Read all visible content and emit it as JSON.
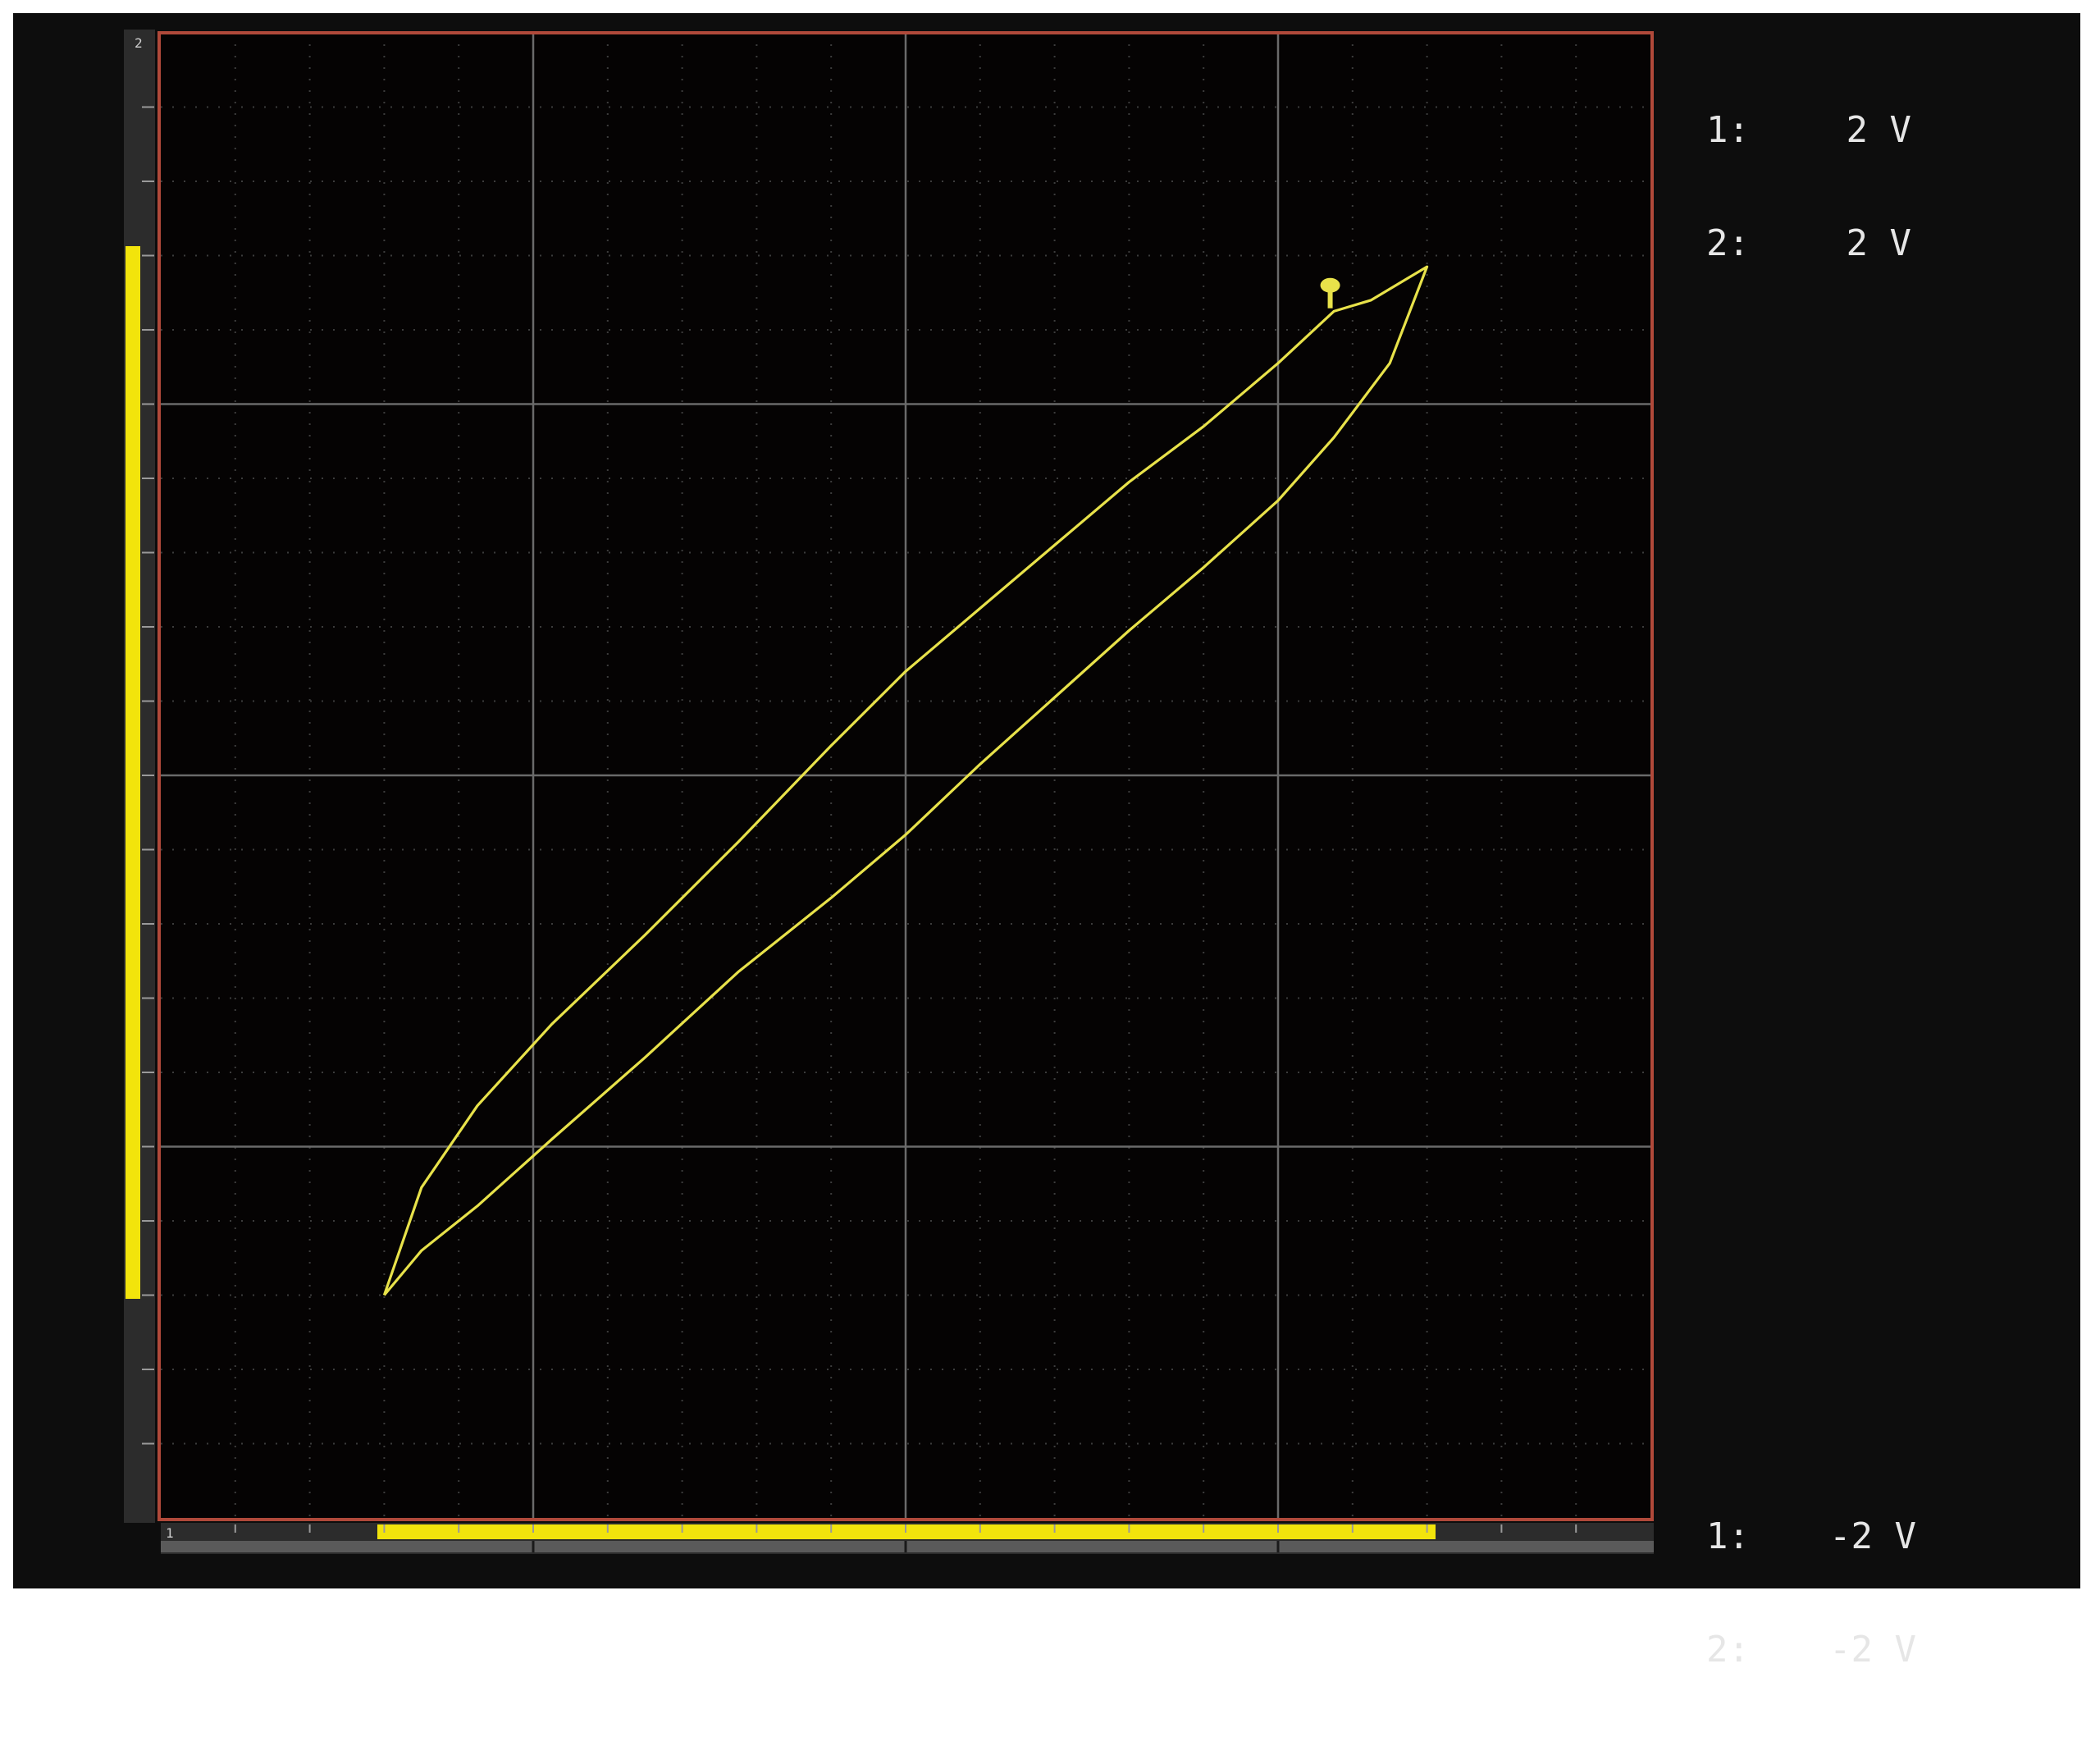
{
  "display": {
    "mode": "XY",
    "trace_color": "#e8e24a",
    "frame_color": "#b0493a",
    "grid_color": "#6a6a6a",
    "background_color": "#050303"
  },
  "y_axis_indicator": {
    "label": "2",
    "channel": 2,
    "highlight_color": "#f2e40c"
  },
  "x_axis_indicator": {
    "label": "1",
    "channel": 1,
    "highlight_color": "#f2e40c"
  },
  "readout_top": [
    {
      "channel": "1:",
      "value": "2 V"
    },
    {
      "channel": "2:",
      "value": "2 V"
    }
  ],
  "readout_bottom": [
    {
      "channel": "1:",
      "value": "-2 V"
    },
    {
      "channel": "2:",
      "value": "-2 V"
    }
  ],
  "chart_data": {
    "type": "line",
    "xlim": [
      -2,
      2
    ],
    "ylim": [
      -2,
      2
    ],
    "grid": true,
    "series": [
      {
        "x": [
          -1.4,
          -1.3,
          -1.15,
          -0.95,
          -0.7,
          -0.45,
          -0.2,
          0.0,
          0.2,
          0.4,
          0.6,
          0.8,
          1.0,
          1.15,
          1.3,
          1.4,
          1.35,
          1.25,
          1.15,
          1.0,
          0.8,
          0.6,
          0.4,
          0.2,
          0.0,
          -0.2,
          -0.45,
          -0.7,
          -0.95,
          -1.15,
          -1.3,
          -1.4
        ],
        "y": [
          -1.4,
          -1.28,
          -1.16,
          -0.98,
          -0.76,
          -0.53,
          -0.33,
          -0.16,
          0.03,
          0.21,
          0.39,
          0.56,
          0.74,
          0.91,
          1.11,
          1.37,
          1.34,
          1.28,
          1.25,
          1.11,
          0.94,
          0.79,
          0.62,
          0.45,
          0.28,
          0.08,
          -0.18,
          -0.43,
          -0.67,
          -0.89,
          -1.11,
          -1.4
        ]
      }
    ],
    "markers": [
      {
        "x": 1.14,
        "y": 1.32
      }
    ]
  }
}
